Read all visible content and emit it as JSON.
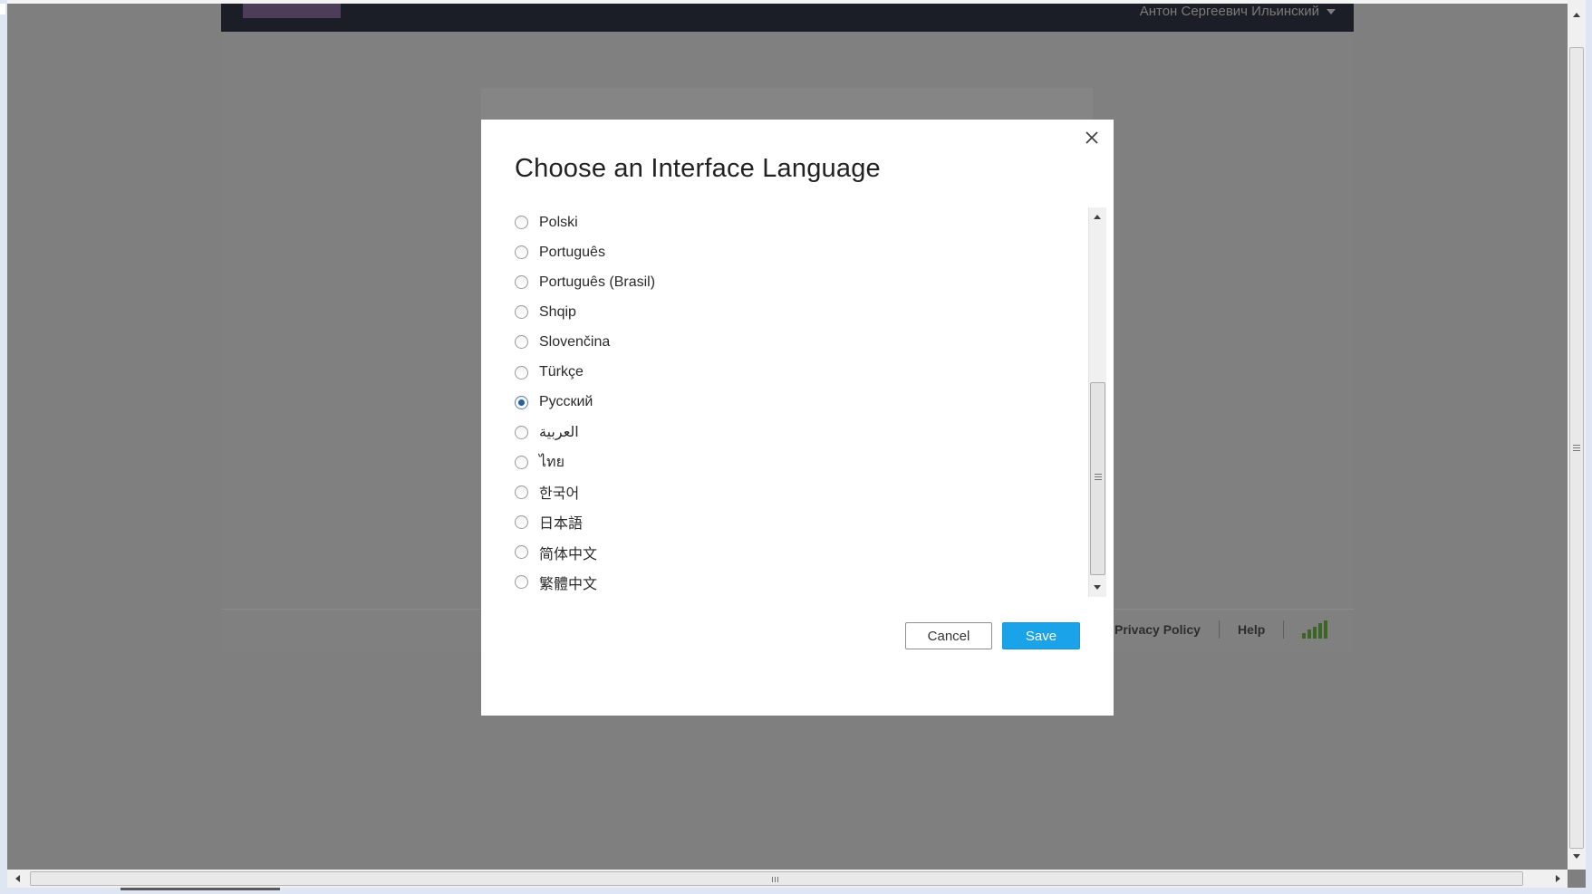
{
  "header": {
    "user_name": "Антон Сергеевич Ильинский"
  },
  "dialog": {
    "title": "Choose an Interface Language",
    "languages": [
      {
        "label": "Polski",
        "selected": false
      },
      {
        "label": "Português",
        "selected": false
      },
      {
        "label": "Português (Brasil)",
        "selected": false
      },
      {
        "label": "Shqip",
        "selected": false
      },
      {
        "label": "Slovenčina",
        "selected": false
      },
      {
        "label": "Türkçe",
        "selected": false
      },
      {
        "label": "Русский",
        "selected": true
      },
      {
        "label": "العربية",
        "selected": false
      },
      {
        "label": "ไทย",
        "selected": false
      },
      {
        "label": "한국어",
        "selected": false
      },
      {
        "label": "日本語",
        "selected": false
      },
      {
        "label": "简体中文",
        "selected": false
      },
      {
        "label": "繁體中文",
        "selected": false
      }
    ],
    "cancel_label": "Cancel",
    "save_label": "Save"
  },
  "footer": {
    "privacy_label": "Privacy Policy",
    "help_label": "Help"
  },
  "colors": {
    "overlay": "#7f7f7f",
    "header_bg": "#1b1e26",
    "save_button": "#1aa3e8",
    "signal_icon": "#3c6424"
  }
}
